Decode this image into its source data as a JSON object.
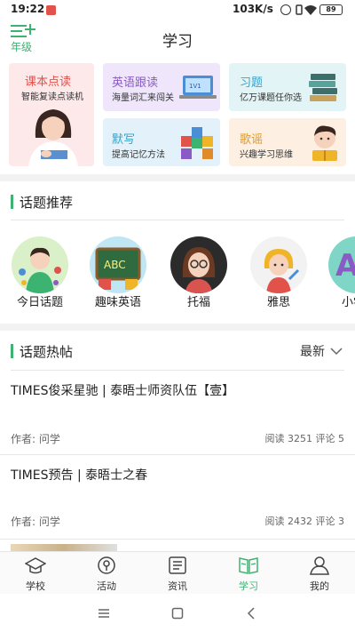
{
  "status_bar": {
    "time": "19:22",
    "network_speed": "103K/s",
    "battery": "89"
  },
  "header": {
    "grade_label": "年级",
    "title": "学习"
  },
  "features": [
    {
      "title": "课本点读",
      "subtitle": "智能复读点读机",
      "title_color": "#e0524a"
    },
    {
      "title": "英语跟读",
      "subtitle": "海量词汇来闯关",
      "title_color": "#8a5bc4"
    },
    {
      "title": "习题",
      "subtitle": "亿万课题任你选",
      "title_color": "#3aa0c8"
    },
    {
      "title": "默写",
      "subtitle": "提高记忆方法",
      "title_color": "#3aa0c8"
    },
    {
      "title": "歌谣",
      "subtitle": "兴趣学习思维",
      "title_color": "#e09a2a"
    }
  ],
  "topics_section": {
    "title": "话题推荐",
    "items": [
      {
        "label": "今日话题"
      },
      {
        "label": "趣味英语"
      },
      {
        "label": "托福"
      },
      {
        "label": "雅思"
      },
      {
        "label": "小学"
      }
    ]
  },
  "posts_section": {
    "title": "话题热帖",
    "sort_label": "最新",
    "posts": [
      {
        "title": "TIMES俊采星驰 | 泰晤士师资队伍【壹】",
        "author": "作者: 问学",
        "stats": "阅读 3251 评论 5"
      },
      {
        "title": "TIMES预告 | 泰晤士之春",
        "author": "作者: 问学",
        "stats": "阅读 2432 评论 3"
      }
    ]
  },
  "tabs": [
    {
      "label": "学校",
      "icon": "school-icon"
    },
    {
      "label": "活动",
      "icon": "location-icon"
    },
    {
      "label": "资讯",
      "icon": "news-icon"
    },
    {
      "label": "学习",
      "icon": "book-icon"
    },
    {
      "label": "我的",
      "icon": "person-icon"
    }
  ],
  "colors": {
    "accent": "#3cb371"
  }
}
